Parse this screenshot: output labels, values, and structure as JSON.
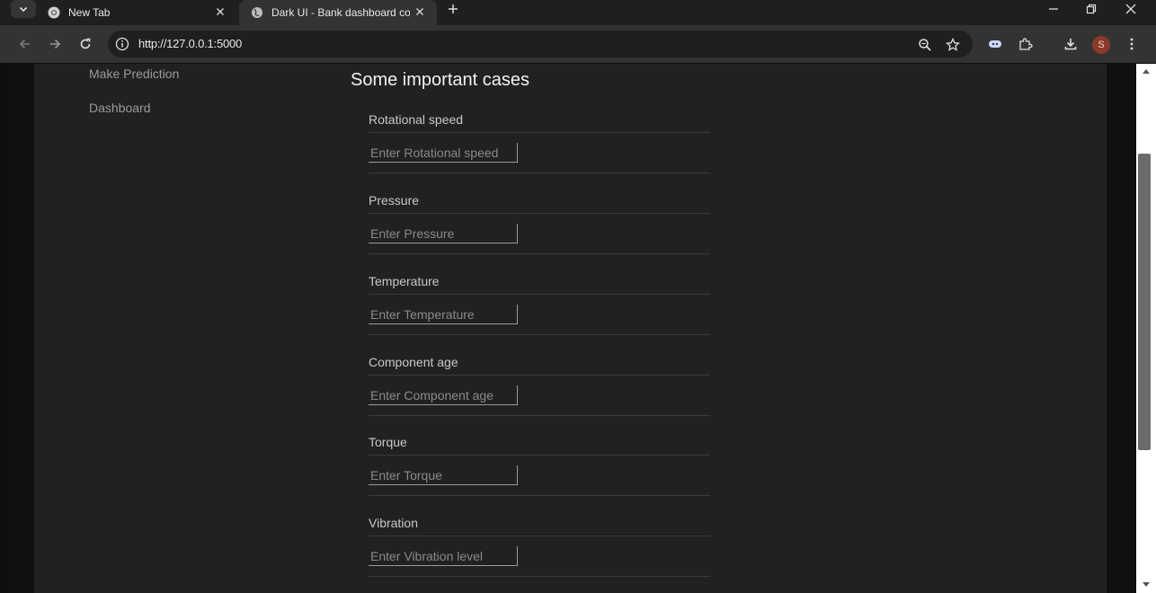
{
  "browser": {
    "tabs": [
      {
        "title": "New Tab",
        "icon": "chrome-icon"
      },
      {
        "title": "Dark UI - Bank dashboard con",
        "icon": "globe-icon"
      }
    ],
    "url": "http://127.0.0.1:5000",
    "profile_initial": "S"
  },
  "sidebar": {
    "items": [
      {
        "label": "Make Prediction"
      },
      {
        "label": "Dashboard"
      }
    ]
  },
  "main": {
    "title": "Some important cases",
    "fields": [
      {
        "label": "Rotational speed",
        "placeholder": "Enter Rotational speed",
        "value": ""
      },
      {
        "label": "Pressure",
        "placeholder": "Enter Pressure",
        "value": ""
      },
      {
        "label": "Temperature",
        "placeholder": "Enter Temperature",
        "value": ""
      },
      {
        "label": "Component age",
        "placeholder": "Enter Component age",
        "value": ""
      },
      {
        "label": "Torque",
        "placeholder": "Enter Torque",
        "value": ""
      },
      {
        "label": "Vibration",
        "placeholder": "Enter Vibration level",
        "value": ""
      }
    ]
  },
  "colors": {
    "page_background": "#212121",
    "browser_chrome": "#333333",
    "text_primary": "#f2f2f2",
    "text_muted": "#9a9a9a"
  }
}
